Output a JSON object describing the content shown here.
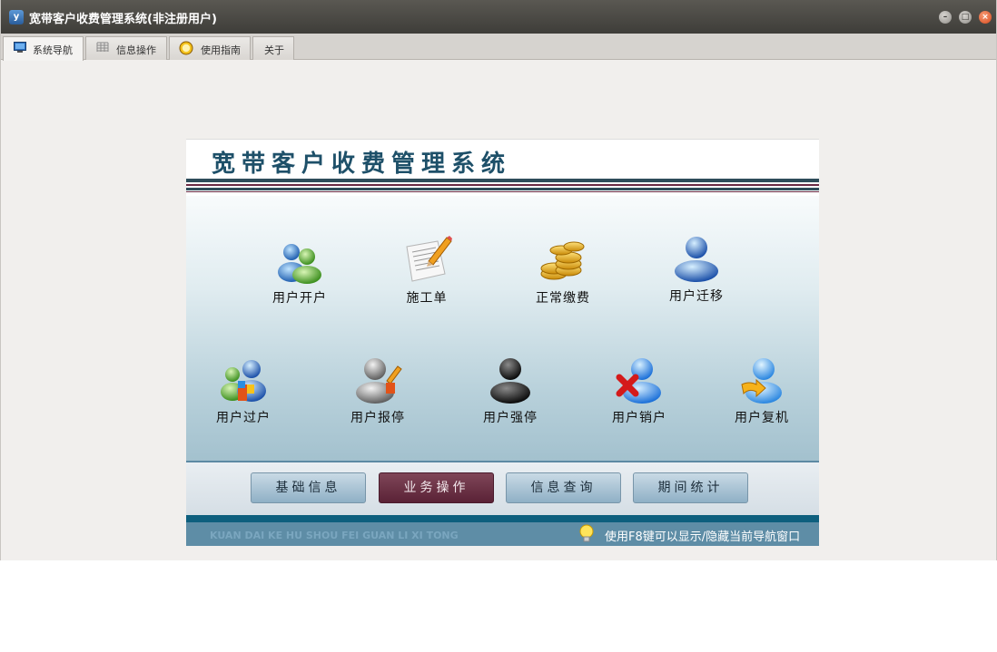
{
  "window": {
    "title": "宽带客户收费管理系统(非注册用户)",
    "app_icon_glyph": "y",
    "controls": {
      "minimize": "–",
      "maximize": "□",
      "close": "×"
    }
  },
  "tabs": [
    {
      "label": "系统导航",
      "icon": "monitor-icon",
      "active": true
    },
    {
      "label": "信息操作",
      "icon": "grid-icon",
      "active": false
    },
    {
      "label": "使用指南",
      "icon": "help-circle-icon",
      "active": false
    },
    {
      "label": "关于",
      "icon": "",
      "active": false
    }
  ],
  "banner": {
    "title": "宽带客户收费管理系统"
  },
  "operations": [
    {
      "label": "用户开户",
      "icon": "users-icon"
    },
    {
      "label": "施工单",
      "icon": "document-pencil-icon"
    },
    {
      "label": "正常缴费",
      "icon": "coins-icon"
    },
    {
      "label": "用户迁移",
      "icon": "user-blue-icon"
    },
    {
      "label": "用户过户",
      "icon": "users-transfer-icon"
    },
    {
      "label": "用户报停",
      "icon": "user-gray-icon"
    },
    {
      "label": "用户强停",
      "icon": "user-black-icon"
    },
    {
      "label": "用户销户",
      "icon": "user-delete-icon"
    },
    {
      "label": "用户复机",
      "icon": "user-restore-icon"
    }
  ],
  "nav_buttons": [
    {
      "label": "基础信息",
      "active": false
    },
    {
      "label": "业务操作",
      "active": true
    },
    {
      "label": "信息查询",
      "active": false
    },
    {
      "label": "期间统计",
      "active": false
    }
  ],
  "footer": {
    "pinyin": "KUAN DAI KE HU SHOU FEI GUAN LI XI TONG",
    "hint": "使用F8键可以显示/隐藏当前导航窗口"
  },
  "colors": {
    "titlebar": "#4a4844",
    "banner_title": "#1e5069",
    "active_button": "#6b3247",
    "footer": "#5e8da6",
    "close_button": "#e0592a"
  }
}
